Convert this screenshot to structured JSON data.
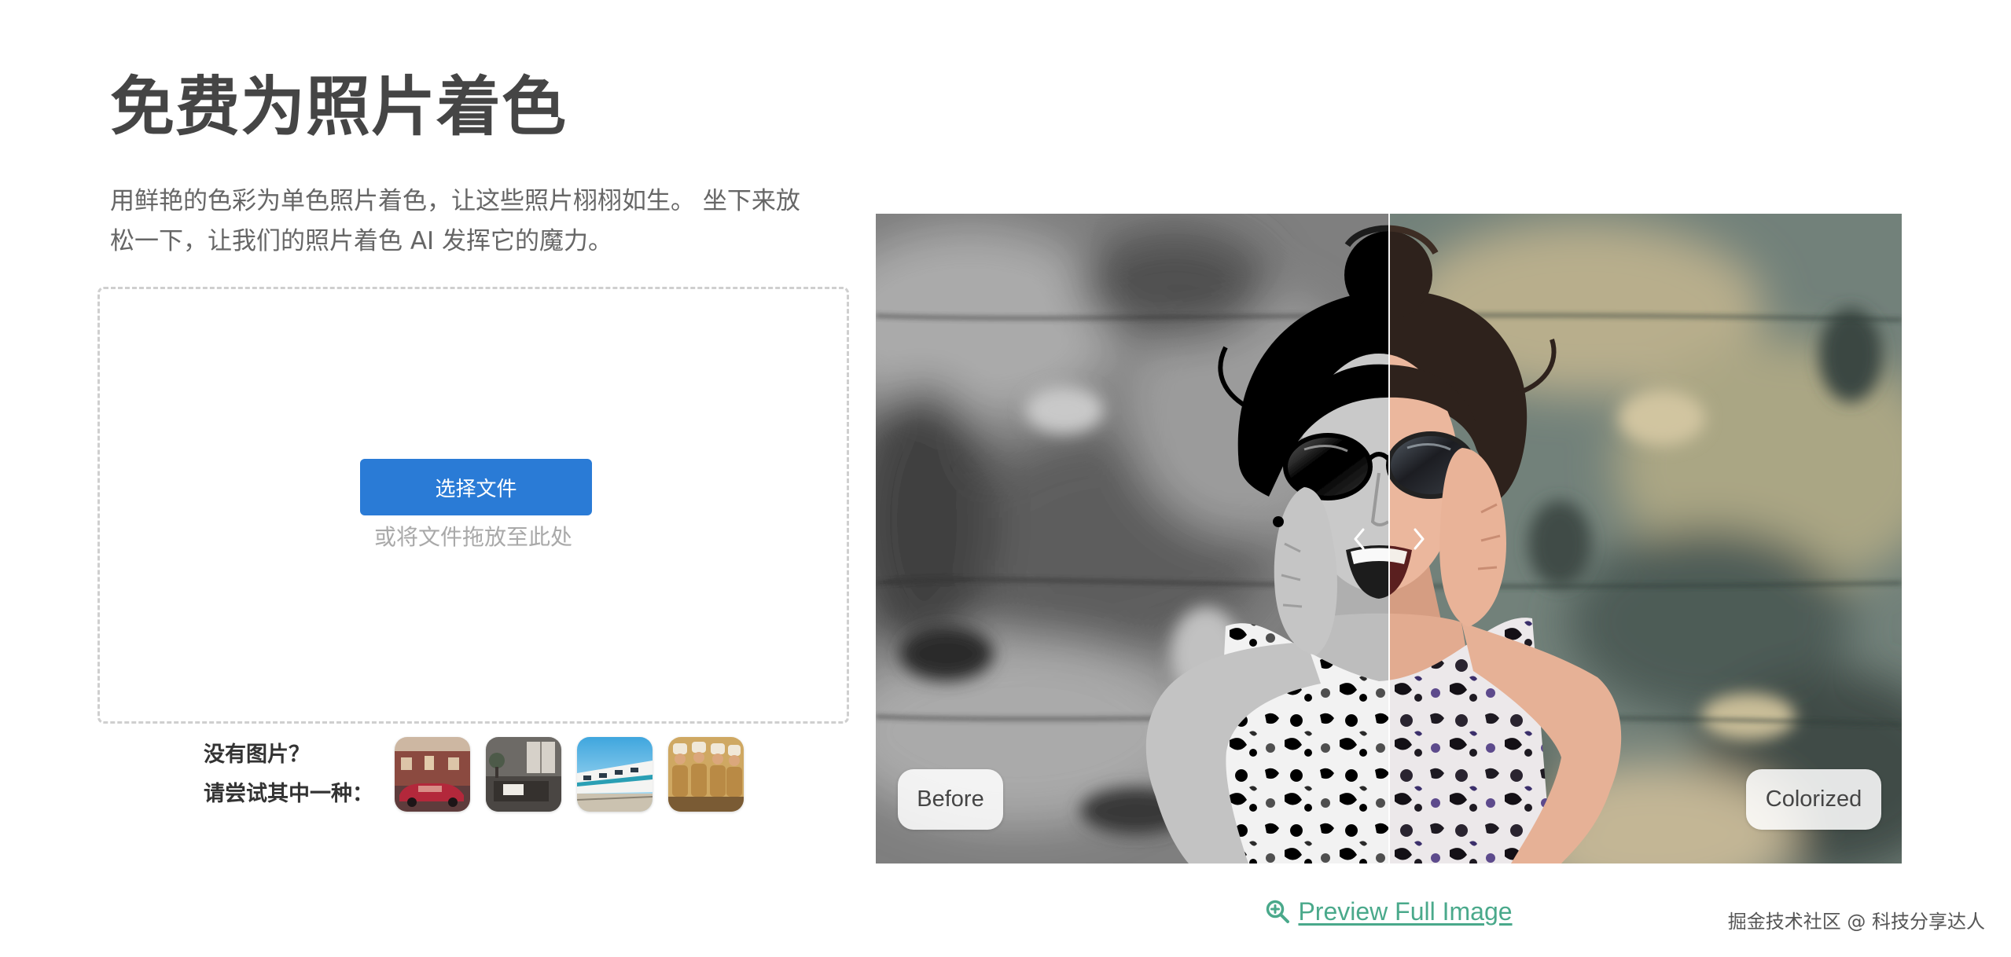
{
  "page": {
    "title": "免费为照片着色",
    "subtitle_lines": [
      "用鲜艳的色彩为单色照片着色，让这些照片栩栩如生。 坐下来放",
      "松一下，让我们的照片着色 AI 发挥它的魔力。"
    ]
  },
  "upload": {
    "button_label": "选择文件",
    "drop_hint": "或将文件拖放至此处"
  },
  "samples": {
    "prompt_line1": "没有图片？",
    "prompt_line2": "请尝试其中一种："
  },
  "compare": {
    "before_label": "Before",
    "after_label": "Colorized",
    "slider_position": 0.5
  },
  "preview": {
    "link_label": "Preview Full Image",
    "icon": "zoom-in-icon"
  },
  "watermark": "掘金技术社区 @ 科技分享达人",
  "icons": [
    "zoom-in-icon",
    "chevron-left-icon",
    "chevron-right-icon"
  ],
  "colors": {
    "primary_button": "#2a7bd6",
    "link": "#4aa98b",
    "title": "#454545",
    "body_text": "#666666",
    "drop_border": "#cfcfcf"
  }
}
